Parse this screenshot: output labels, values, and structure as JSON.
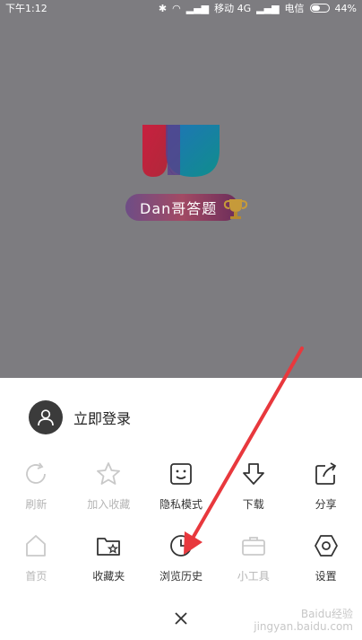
{
  "status_bar": {
    "time": "下午1:12",
    "carrier1": "移动 4G",
    "carrier2": "电信",
    "battery": "44%"
  },
  "brand": {
    "pill_text": "Dan哥答题"
  },
  "sheet": {
    "login_label": "立即登录",
    "row1": [
      {
        "label": "刷新",
        "icon": "refresh-icon",
        "enabled": false
      },
      {
        "label": "加入收藏",
        "icon": "star-icon",
        "enabled": false
      },
      {
        "label": "隐私模式",
        "icon": "incognito-face-icon",
        "enabled": true
      },
      {
        "label": "下载",
        "icon": "download-icon",
        "enabled": true
      },
      {
        "label": "分享",
        "icon": "share-icon",
        "enabled": true
      }
    ],
    "row2": [
      {
        "label": "首页",
        "icon": "home-icon",
        "enabled": false
      },
      {
        "label": "收藏夹",
        "icon": "bookmarks-folder-icon",
        "enabled": true
      },
      {
        "label": "浏览历史",
        "icon": "clock-icon",
        "enabled": true
      },
      {
        "label": "小工具",
        "icon": "toolbox-icon",
        "enabled": false
      },
      {
        "label": "设置",
        "icon": "settings-icon",
        "enabled": true
      }
    ]
  },
  "watermark": {
    "line1": "Baidu经验",
    "line2": "jingyan.baidu.com"
  },
  "colors": {
    "annotation_arrow": "#e8383d",
    "dim_overlay": "#7d7c80"
  }
}
